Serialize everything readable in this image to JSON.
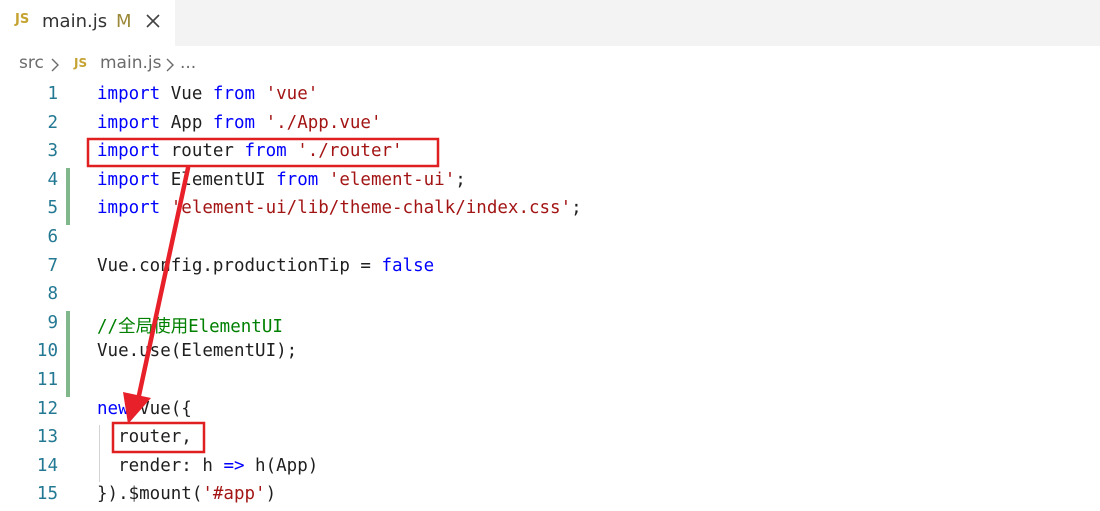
{
  "tab": {
    "badge": "JS",
    "filename": "main.js",
    "status": "M"
  },
  "breadcrumb": {
    "folder": "src",
    "badge": "JS",
    "file": "main.js",
    "more": "..."
  },
  "lines": [
    {
      "num": "1",
      "tokens": [
        {
          "t": "import",
          "c": "kw"
        },
        {
          "t": " Vue ",
          "c": "id"
        },
        {
          "t": "from",
          "c": "kw"
        },
        {
          "t": " ",
          "c": "id"
        },
        {
          "t": "'vue'",
          "c": "str"
        }
      ]
    },
    {
      "num": "2",
      "tokens": [
        {
          "t": "import",
          "c": "kw"
        },
        {
          "t": " App ",
          "c": "id"
        },
        {
          "t": "from",
          "c": "kw"
        },
        {
          "t": " ",
          "c": "id"
        },
        {
          "t": "'./App.vue'",
          "c": "str"
        }
      ]
    },
    {
      "num": "3",
      "tokens": [
        {
          "t": "import",
          "c": "kw"
        },
        {
          "t": " router ",
          "c": "id"
        },
        {
          "t": "from",
          "c": "kw"
        },
        {
          "t": " ",
          "c": "id"
        },
        {
          "t": "'./router'",
          "c": "str"
        }
      ]
    },
    {
      "num": "4",
      "modified": true,
      "tokens": [
        {
          "t": "import",
          "c": "kw"
        },
        {
          "t": " ElementUI ",
          "c": "id"
        },
        {
          "t": "from",
          "c": "kw"
        },
        {
          "t": " ",
          "c": "id"
        },
        {
          "t": "'element-ui'",
          "c": "str"
        },
        {
          "t": ";",
          "c": "id"
        }
      ]
    },
    {
      "num": "5",
      "modified": true,
      "tokens": [
        {
          "t": "import",
          "c": "kw"
        },
        {
          "t": " ",
          "c": "id"
        },
        {
          "t": "'element-ui/lib/theme-chalk/index.css'",
          "c": "str"
        },
        {
          "t": ";",
          "c": "id"
        }
      ]
    },
    {
      "num": "6",
      "tokens": []
    },
    {
      "num": "7",
      "tokens": [
        {
          "t": "Vue.config.productionTip = ",
          "c": "id"
        },
        {
          "t": "false",
          "c": "kw"
        }
      ]
    },
    {
      "num": "8",
      "tokens": []
    },
    {
      "num": "9",
      "modified": true,
      "tokens": [
        {
          "t": "//全局使用ElementUI",
          "c": "cm"
        }
      ]
    },
    {
      "num": "10",
      "modified": true,
      "tokens": [
        {
          "t": "Vue.use(ElementUI);",
          "c": "id"
        }
      ]
    },
    {
      "num": "11",
      "modified": true,
      "tokens": []
    },
    {
      "num": "12",
      "tokens": [
        {
          "t": "new",
          "c": "kw"
        },
        {
          "t": " Vue({",
          "c": "id"
        }
      ]
    },
    {
      "num": "13",
      "tokens": [
        {
          "t": "  router,",
          "c": "id"
        }
      ]
    },
    {
      "num": "14",
      "tokens": [
        {
          "t": "  render: h ",
          "c": "id"
        },
        {
          "t": "=>",
          "c": "kw"
        },
        {
          "t": " h(App)",
          "c": "id"
        }
      ]
    },
    {
      "num": "15",
      "tokens": [
        {
          "t": "}).$mount(",
          "c": "id"
        },
        {
          "t": "'#app'",
          "c": "str"
        },
        {
          "t": ")",
          "c": "id"
        }
      ]
    }
  ],
  "colors": {
    "highlight_box": "#e02020",
    "arrow": "#e8202a",
    "gutter_modified": "#81b88b"
  }
}
